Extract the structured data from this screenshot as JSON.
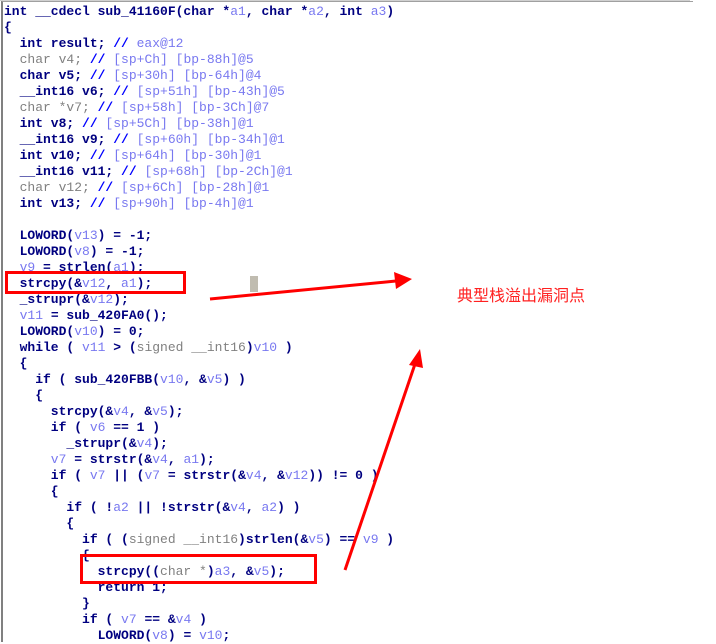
{
  "annotation": {
    "label": "典型栈溢出漏洞点",
    "color": "#ff0000"
  },
  "code_lines": [
    [
      [
        "k",
        "int __cdecl sub_41160F(char *"
      ],
      [
        "v",
        "a1"
      ],
      [
        "k",
        ", char *"
      ],
      [
        "v",
        "a2"
      ],
      [
        "k",
        ", int "
      ],
      [
        "v",
        "a3"
      ],
      [
        "k",
        ")"
      ]
    ],
    [
      [
        "k",
        "{"
      ]
    ],
    [
      [
        "k",
        "  int result; "
      ],
      [
        "c",
        "// "
      ],
      [
        "m",
        "eax@12"
      ]
    ],
    [
      [
        "g",
        "  char v4; "
      ],
      [
        "c",
        "// "
      ],
      [
        "m",
        "[sp+Ch] [bp-88h]@5"
      ]
    ],
    [
      [
        "k",
        "  char v5; "
      ],
      [
        "c",
        "// "
      ],
      [
        "m",
        "[sp+30h] [bp-64h]@4"
      ]
    ],
    [
      [
        "k",
        "  __int16 v6; "
      ],
      [
        "c",
        "// "
      ],
      [
        "m",
        "[sp+51h] [bp-43h]@5"
      ]
    ],
    [
      [
        "g",
        "  char *v7; "
      ],
      [
        "c",
        "// "
      ],
      [
        "m",
        "[sp+58h] [bp-3Ch]@7"
      ]
    ],
    [
      [
        "k",
        "  int v8; "
      ],
      [
        "c",
        "// "
      ],
      [
        "m",
        "[sp+5Ch] [bp-38h]@1"
      ]
    ],
    [
      [
        "k",
        "  __int16 v9; "
      ],
      [
        "c",
        "// "
      ],
      [
        "m",
        "[sp+60h] [bp-34h]@1"
      ]
    ],
    [
      [
        "k",
        "  int v10; "
      ],
      [
        "c",
        "// "
      ],
      [
        "m",
        "[sp+64h] [bp-30h]@1"
      ]
    ],
    [
      [
        "k",
        "  __int16 v11; "
      ],
      [
        "c",
        "// "
      ],
      [
        "m",
        "[sp+68h] [bp-2Ch]@1"
      ]
    ],
    [
      [
        "g",
        "  char v12; "
      ],
      [
        "c",
        "// "
      ],
      [
        "m",
        "[sp+6Ch] [bp-28h]@1"
      ]
    ],
    [
      [
        "k",
        "  int v13; "
      ],
      [
        "c",
        "// "
      ],
      [
        "m",
        "[sp+90h] [bp-4h]@1"
      ]
    ],
    [
      [
        "k",
        " "
      ]
    ],
    [
      [
        "k",
        "  LOWORD("
      ],
      [
        "v",
        "v13"
      ],
      [
        "k",
        ") = -1;"
      ]
    ],
    [
      [
        "k",
        "  LOWORD("
      ],
      [
        "v",
        "v8"
      ],
      [
        "k",
        ") = -1;"
      ]
    ],
    [
      [
        "v",
        "  v9"
      ],
      [
        "k",
        " = strlen("
      ],
      [
        "v",
        "a1"
      ],
      [
        "k",
        ");"
      ]
    ],
    [
      [
        "k",
        "  strcpy(&"
      ],
      [
        "v",
        "v12"
      ],
      [
        "k",
        ", "
      ],
      [
        "v",
        "a1"
      ],
      [
        "k",
        ");"
      ]
    ],
    [
      [
        "k",
        "  _strupr(&"
      ],
      [
        "v",
        "v12"
      ],
      [
        "k",
        ");"
      ]
    ],
    [
      [
        "v",
        "  v11"
      ],
      [
        "k",
        " = sub_420FA0();"
      ]
    ],
    [
      [
        "k",
        "  LOWORD("
      ],
      [
        "v",
        "v10"
      ],
      [
        "k",
        ") = 0;"
      ]
    ],
    [
      [
        "k",
        "  while ( "
      ],
      [
        "v",
        "v11"
      ],
      [
        "k",
        " > ("
      ],
      [
        "g",
        "signed __int16"
      ],
      [
        "k",
        ")"
      ],
      [
        "v",
        "v10"
      ],
      [
        "k",
        " )"
      ]
    ],
    [
      [
        "k",
        "  {"
      ]
    ],
    [
      [
        "k",
        "    if ( sub_420FBB("
      ],
      [
        "v",
        "v10"
      ],
      [
        "k",
        ", &"
      ],
      [
        "v",
        "v5"
      ],
      [
        "k",
        ") )"
      ]
    ],
    [
      [
        "k",
        "    {"
      ]
    ],
    [
      [
        "k",
        "      strcpy(&"
      ],
      [
        "v",
        "v4"
      ],
      [
        "k",
        ", &"
      ],
      [
        "v",
        "v5"
      ],
      [
        "k",
        ");"
      ]
    ],
    [
      [
        "k",
        "      if ( "
      ],
      [
        "v",
        "v6"
      ],
      [
        "k",
        " == 1 )"
      ]
    ],
    [
      [
        "k",
        "        _strupr(&"
      ],
      [
        "v",
        "v4"
      ],
      [
        "k",
        ");"
      ]
    ],
    [
      [
        "v",
        "      v7"
      ],
      [
        "k",
        " = strstr(&"
      ],
      [
        "v",
        "v4"
      ],
      [
        "k",
        ", "
      ],
      [
        "v",
        "a1"
      ],
      [
        "k",
        ");"
      ]
    ],
    [
      [
        "k",
        "      if ( "
      ],
      [
        "v",
        "v7"
      ],
      [
        "k",
        " || ("
      ],
      [
        "v",
        "v7"
      ],
      [
        "k",
        " = strstr(&"
      ],
      [
        "v",
        "v4"
      ],
      [
        "k",
        ", &"
      ],
      [
        "v",
        "v12"
      ],
      [
        "k",
        ")) != 0 )"
      ]
    ],
    [
      [
        "k",
        "      {"
      ]
    ],
    [
      [
        "k",
        "        if ( !"
      ],
      [
        "v",
        "a2"
      ],
      [
        "k",
        " || !strstr(&"
      ],
      [
        "v",
        "v4"
      ],
      [
        "k",
        ", "
      ],
      [
        "v",
        "a2"
      ],
      [
        "k",
        ") )"
      ]
    ],
    [
      [
        "k",
        "        {"
      ]
    ],
    [
      [
        "k",
        "          if ( ("
      ],
      [
        "g",
        "signed __int16"
      ],
      [
        "k",
        ")strlen(&"
      ],
      [
        "v",
        "v5"
      ],
      [
        "k",
        ") == "
      ],
      [
        "v",
        "v9"
      ],
      [
        "k",
        " )"
      ]
    ],
    [
      [
        "k",
        "          {"
      ]
    ],
    [
      [
        "k",
        "            strcpy(("
      ],
      [
        "g",
        "char *"
      ],
      [
        "k",
        ")"
      ],
      [
        "v",
        "a3"
      ],
      [
        "k",
        ", &"
      ],
      [
        "v",
        "v5"
      ],
      [
        "k",
        ");"
      ]
    ],
    [
      [
        "k",
        "            return 1;"
      ]
    ],
    [
      [
        "k",
        "          }"
      ]
    ],
    [
      [
        "k",
        "          if ( "
      ],
      [
        "v",
        "v7"
      ],
      [
        "k",
        " == &"
      ],
      [
        "v",
        "v4"
      ],
      [
        "k",
        " )"
      ]
    ],
    [
      [
        "k",
        "            LOWORD("
      ],
      [
        "v",
        "v8"
      ],
      [
        "k",
        ") = "
      ],
      [
        "v",
        "v10"
      ],
      [
        "k",
        ";"
      ]
    ]
  ]
}
